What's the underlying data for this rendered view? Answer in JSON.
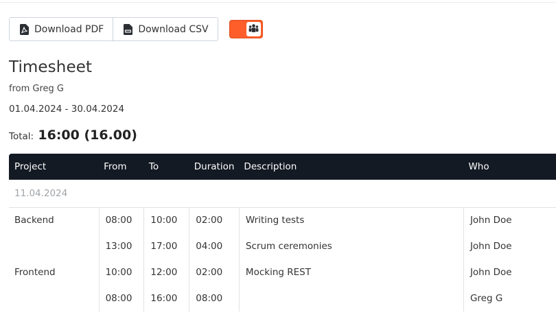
{
  "toolbar": {
    "download_pdf_label": "Download PDF",
    "download_csv_label": "Download CSV",
    "toggle_on": true,
    "toggle_icon": "users-icon",
    "accent_color": "#fd5e2a"
  },
  "header": {
    "title": "Timesheet",
    "subtitle": "from Greg G",
    "date_range": "01.04.2024 - 30.04.2024",
    "total_label": "Total:",
    "total_value": "16:00 (16.00)"
  },
  "table": {
    "columns": [
      "Project",
      "From",
      "To",
      "Duration",
      "Description",
      "Who"
    ],
    "group_date": "11.04.2024",
    "rows": [
      {
        "project": "Backend",
        "from": "08:00",
        "to": "10:00",
        "duration": "02:00",
        "description": "Writing tests",
        "who": "John Doe"
      },
      {
        "project": "",
        "from": "13:00",
        "to": "17:00",
        "duration": "04:00",
        "description": "Scrum ceremonies",
        "who": "John Doe"
      },
      {
        "project": "Frontend",
        "from": "10:00",
        "to": "12:00",
        "duration": "02:00",
        "description": "Mocking REST",
        "who": "John Doe"
      },
      {
        "project": "",
        "from": "08:00",
        "to": "16:00",
        "duration": "08:00",
        "description": "",
        "who": "Greg G"
      }
    ]
  }
}
